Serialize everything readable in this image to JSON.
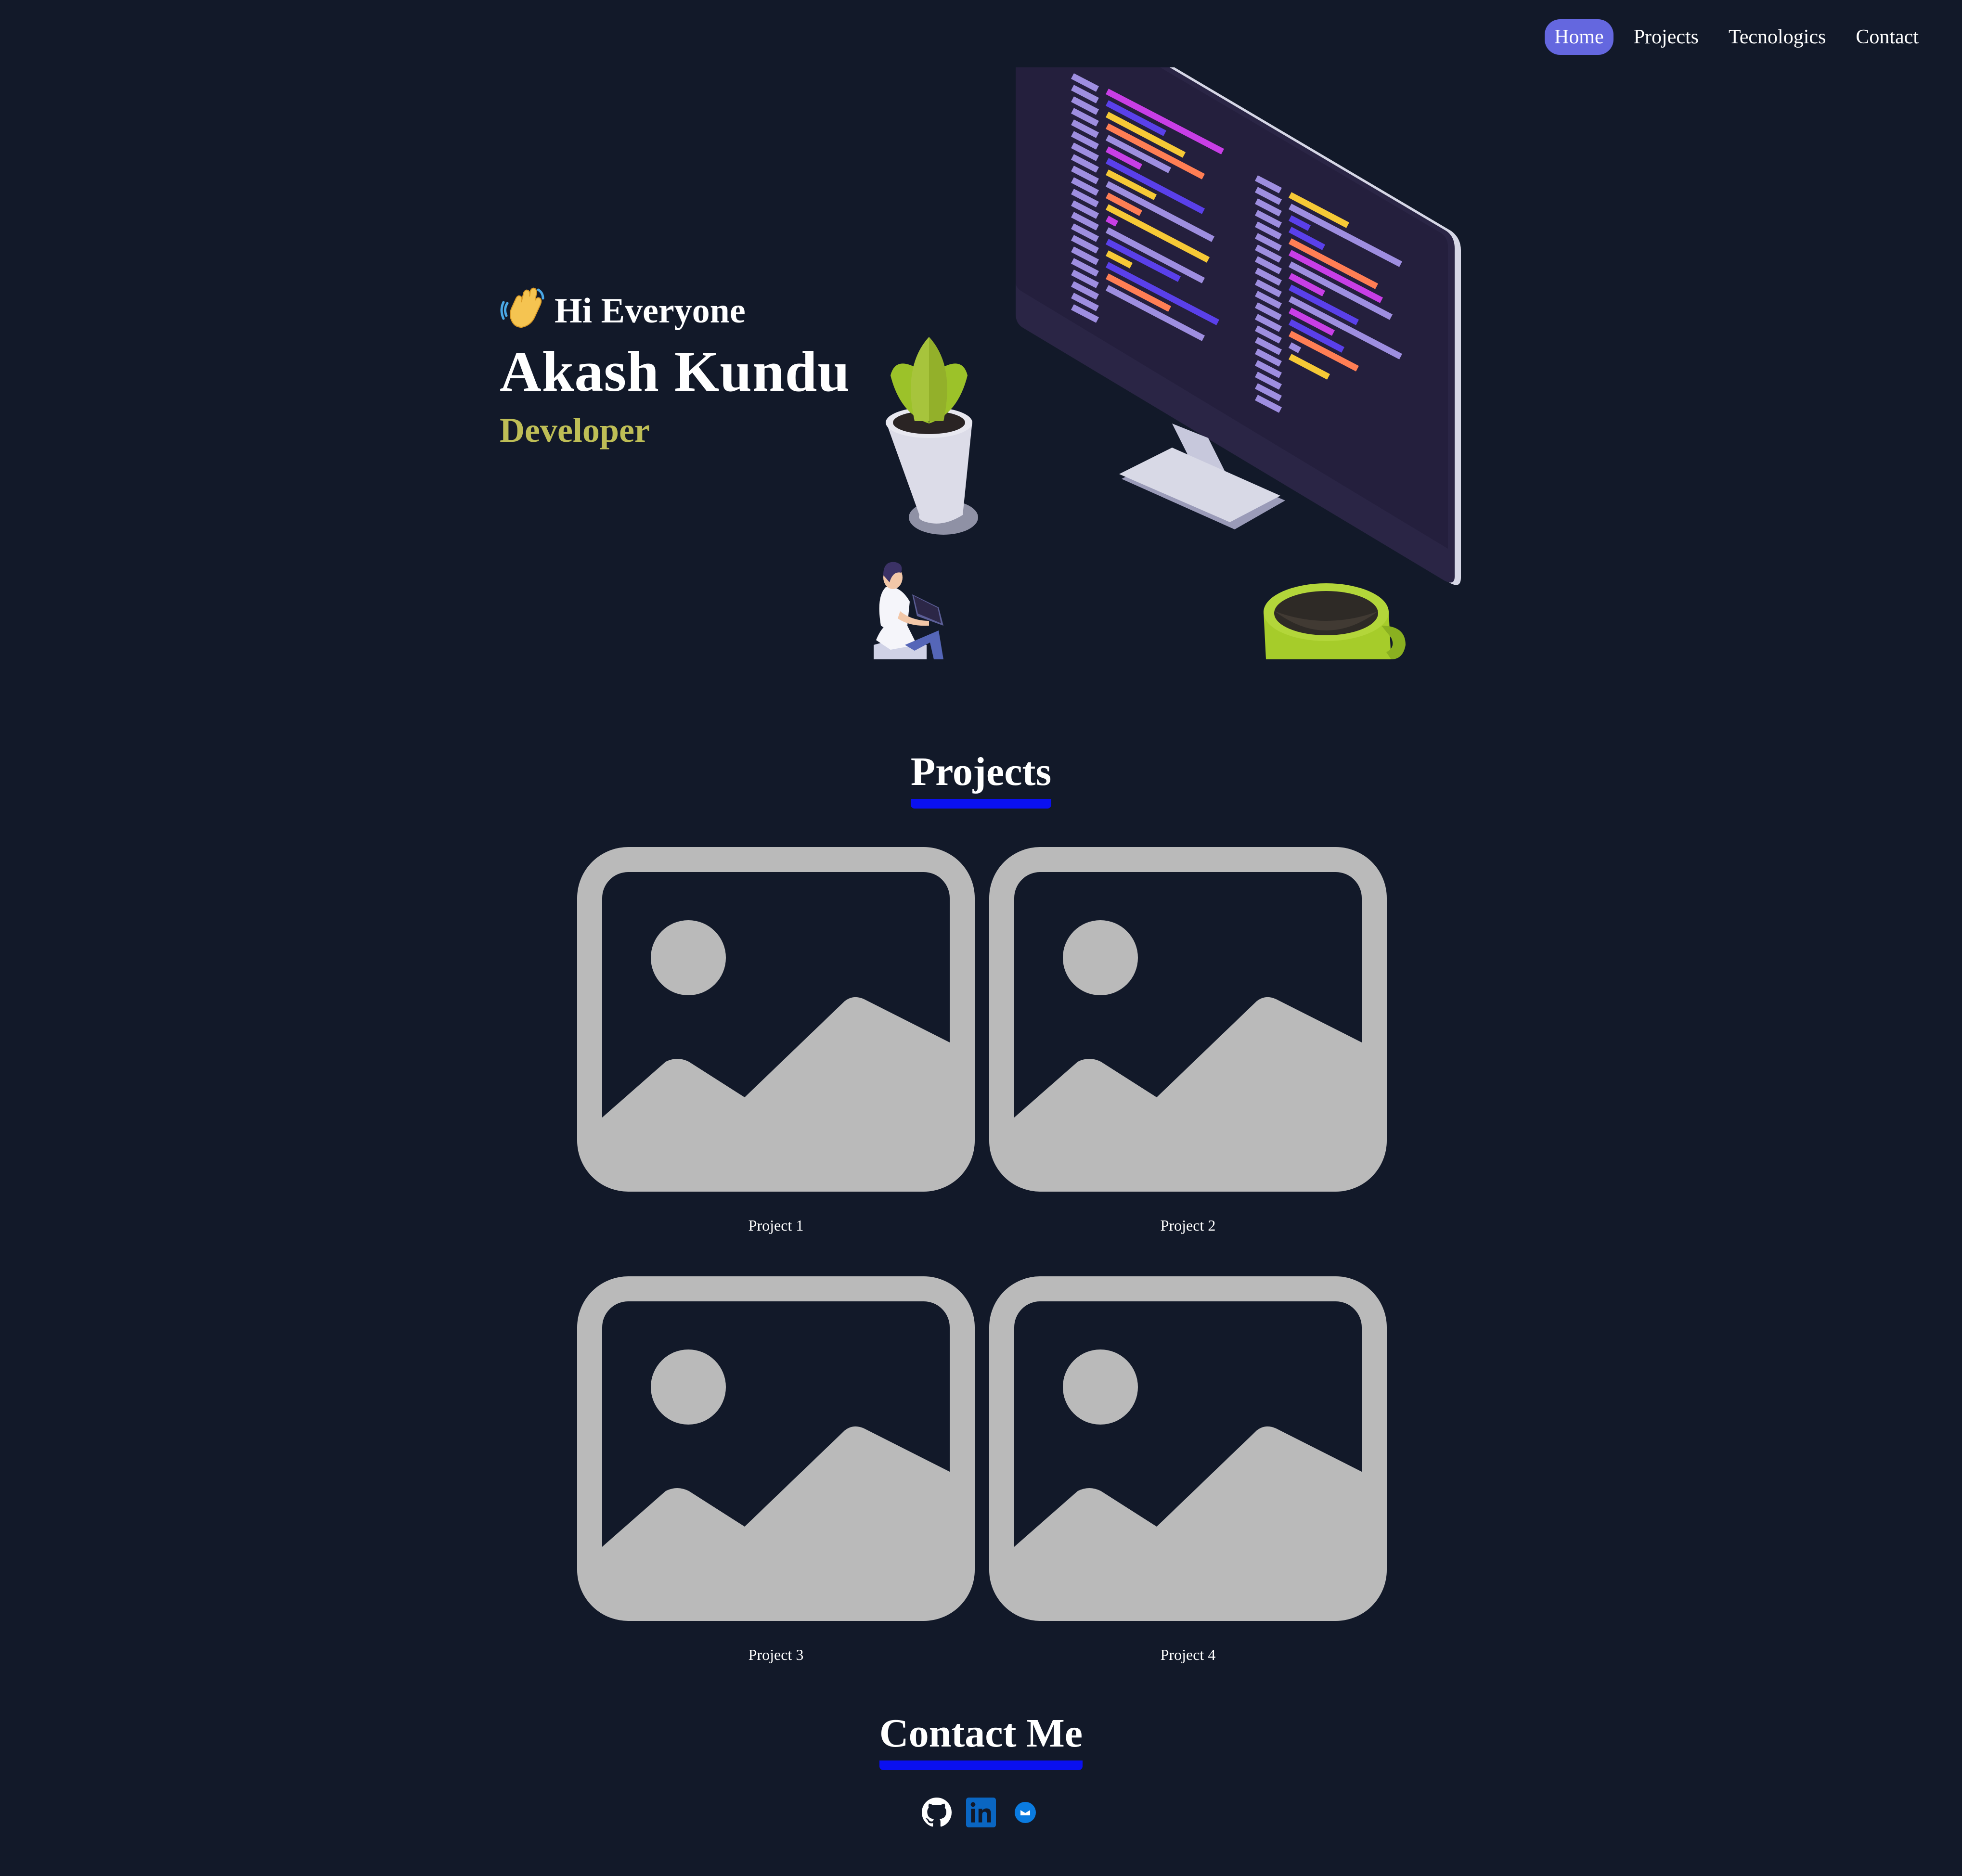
{
  "nav": {
    "items": [
      {
        "label": "Home",
        "active": true
      },
      {
        "label": "Projects",
        "active": false
      },
      {
        "label": "Tecnologics",
        "active": false
      },
      {
        "label": "Contact",
        "active": false
      }
    ]
  },
  "hero": {
    "greeting_emoji": "👋",
    "greeting": "Hi Everyone",
    "name": "Akash Kundu",
    "role": "Developer",
    "illustration": "developer-desk-illustration"
  },
  "projects": {
    "title": "Projects",
    "items": [
      {
        "label": "Project 1",
        "thumbnail_icon": "image-placeholder-icon"
      },
      {
        "label": "Project 2",
        "thumbnail_icon": "image-placeholder-icon"
      },
      {
        "label": "Project 3",
        "thumbnail_icon": "image-placeholder-icon"
      },
      {
        "label": "Project 4",
        "thumbnail_icon": "image-placeholder-icon"
      }
    ]
  },
  "contact": {
    "title": "Contact Me",
    "icons": [
      "github-icon",
      "linkedin-icon",
      "email-icon"
    ]
  },
  "colors": {
    "background": "#121929",
    "nav_active": "#6467df",
    "role": "#bebe56",
    "underline": "#0a10f0",
    "placeholder": "#bababa"
  }
}
